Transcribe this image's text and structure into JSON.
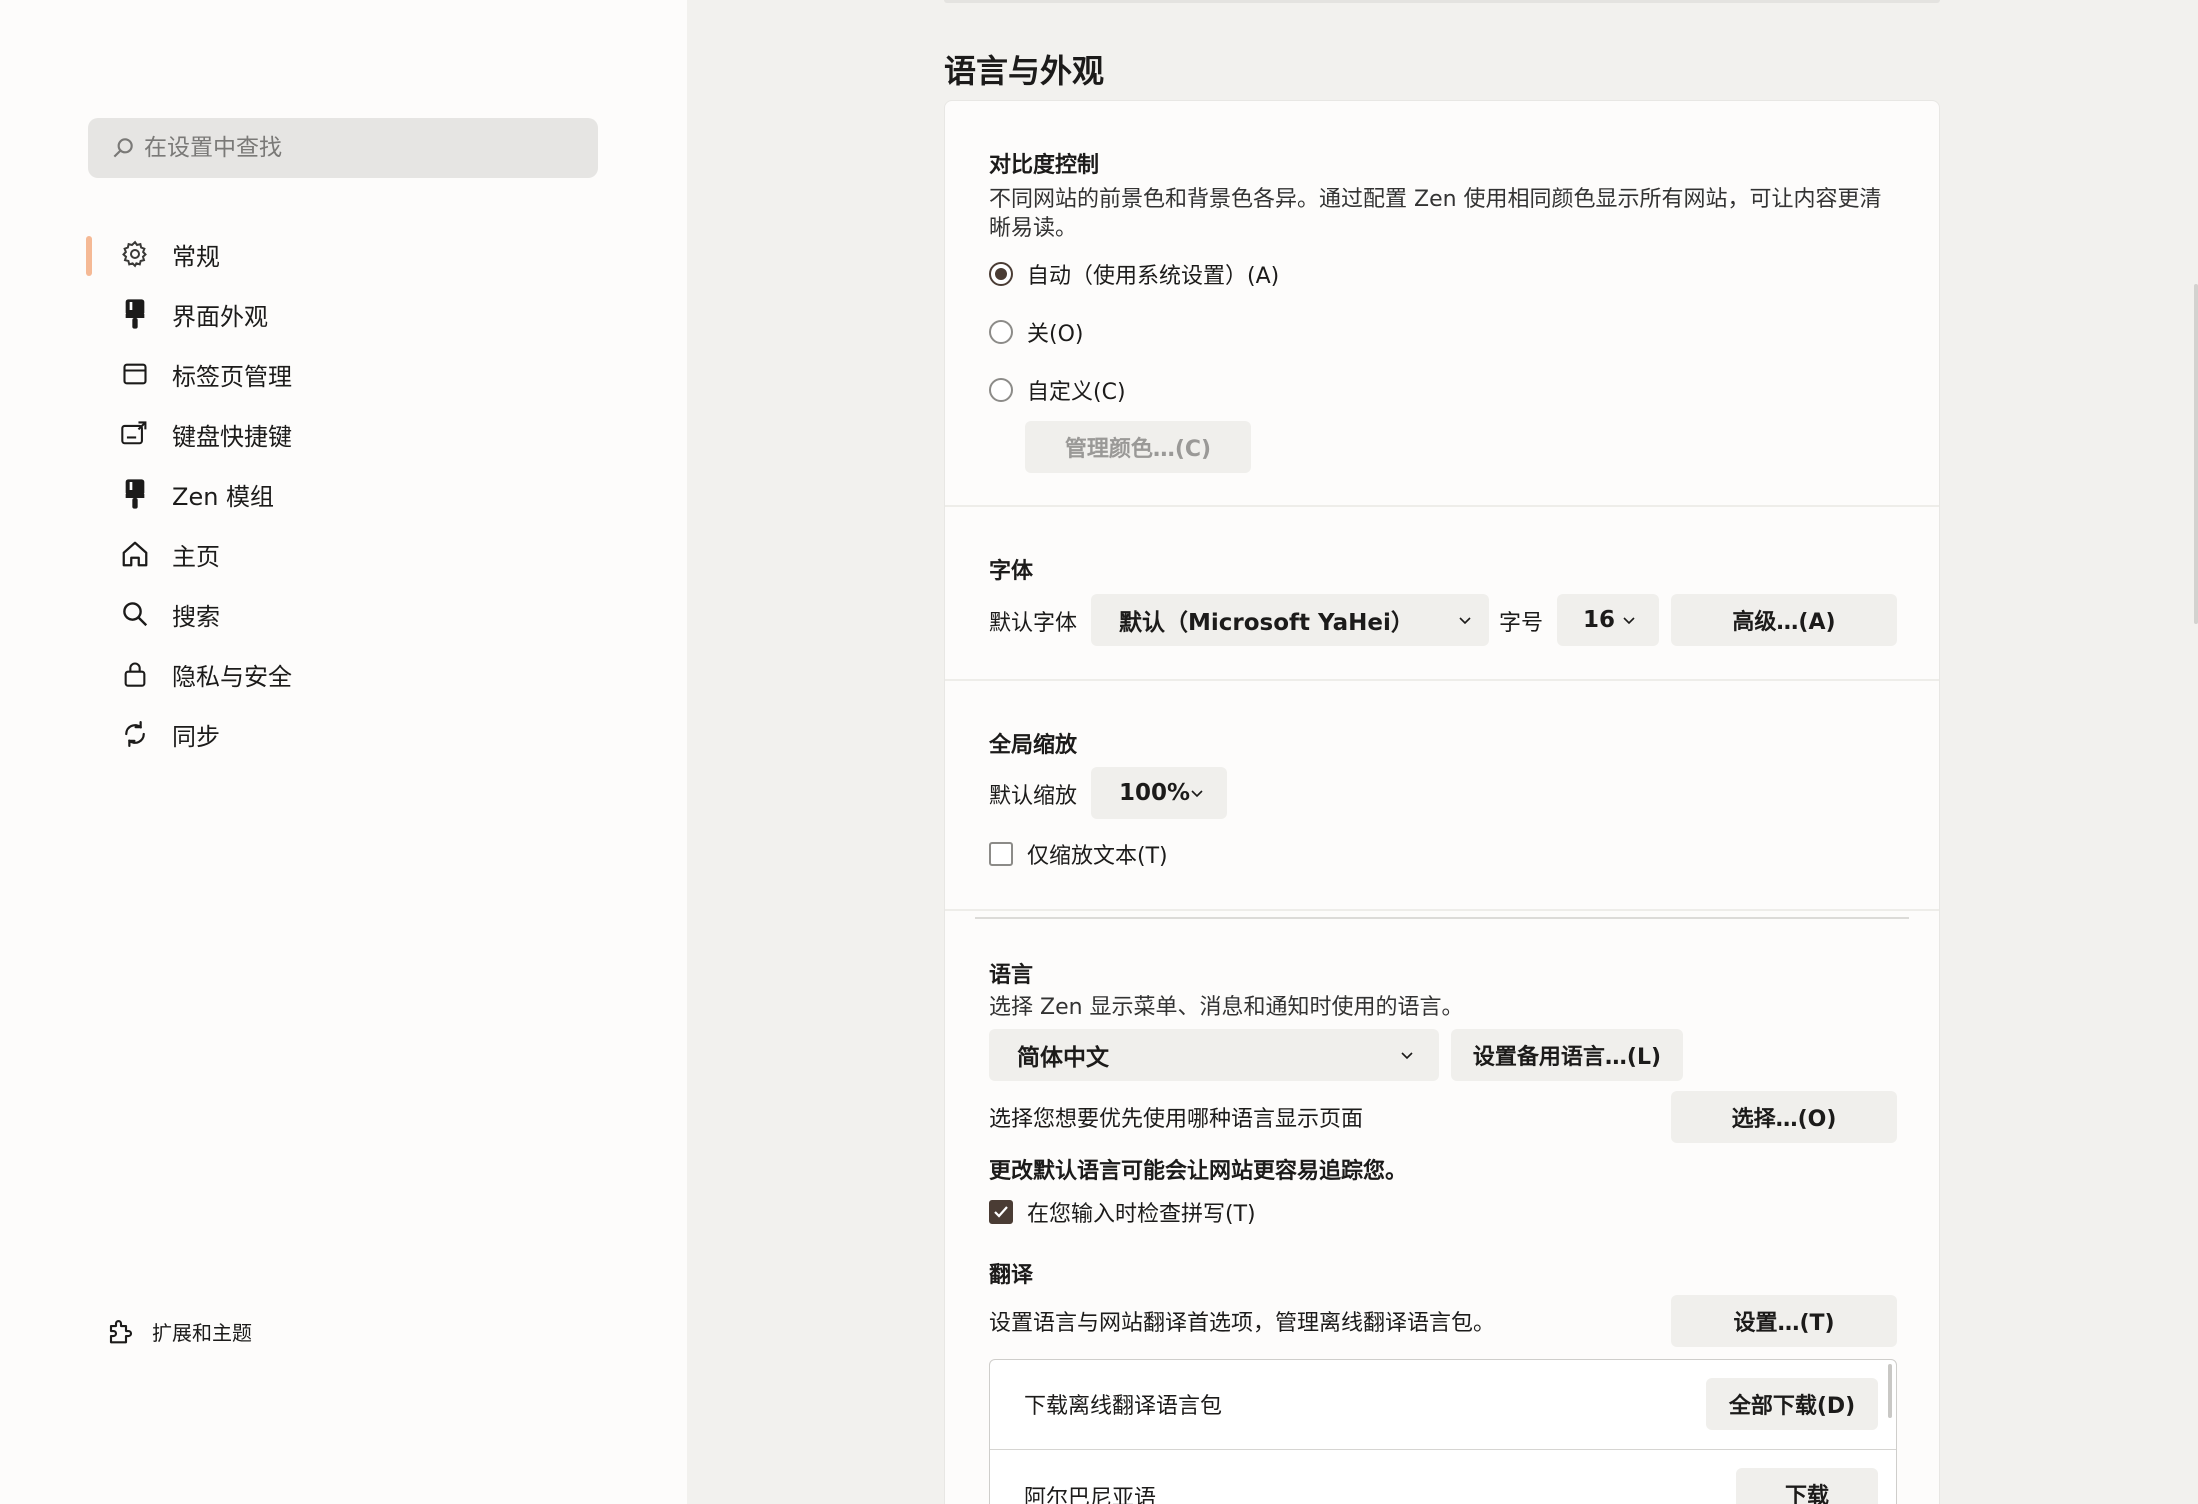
{
  "sidebar": {
    "search_placeholder": "在设置中查找",
    "accent_color": "#f5b995",
    "items": [
      {
        "label": "常规",
        "icon": "gear-icon",
        "active": true
      },
      {
        "label": "界面外观",
        "icon": "paintbrush-icon"
      },
      {
        "label": "标签页管理",
        "icon": "window-icon"
      },
      {
        "label": "键盘快捷键",
        "icon": "keyboard-shortcut-icon"
      },
      {
        "label": "Zen 模组",
        "icon": "paintbrush-icon"
      },
      {
        "label": "主页",
        "icon": "home-icon"
      },
      {
        "label": "搜索",
        "icon": "search-icon"
      },
      {
        "label": "隐私与安全",
        "icon": "lock-icon"
      },
      {
        "label": "同步",
        "icon": "sync-icon"
      }
    ],
    "footer_label": "扩展和主题"
  },
  "main": {
    "title": "语言与外观",
    "contrast": {
      "title": "对比度控制",
      "description": "不同网站的前景色和背景色各异。通过配置 Zen 使用相同颜色显示所有网站，可让内容更清晰易读。",
      "options": [
        "自动（使用系统设置）(A)",
        "关(O)",
        "自定义(C)"
      ],
      "selected": 0,
      "manage_colors_label": "管理颜色…(C)"
    },
    "fonts": {
      "title": "字体",
      "default_font_label": "默认字体",
      "default_font_value": "默认（Microsoft YaHei）",
      "size_label": "字号",
      "size_value": "16",
      "advanced_label": "高级…(A)"
    },
    "zoom": {
      "title": "全局缩放",
      "default_zoom_label": "默认缩放",
      "default_zoom_value": "100%",
      "text_only_label": "仅缩放文本(T)",
      "text_only_checked": false
    },
    "language": {
      "title": "语言",
      "description": "选择 Zen 显示菜单、消息和通知时使用的语言。",
      "selected_language": "简体中文",
      "alternatives_label": "设置备用语言…(L)",
      "page_language_label": "选择您想要优先使用哪种语言显示页面",
      "choose_label": "选择…(O)",
      "warning": "更改默认语言可能会让网站更容易追踪您。",
      "spellcheck_label": "在您输入时检查拼写(T)",
      "spellcheck_checked": true
    },
    "translation": {
      "title": "翻译",
      "description": "设置语言与网站翻译首选项，管理离线翻译语言包。",
      "settings_label": "设置…(T)",
      "rows": [
        {
          "label": "下载离线翻译语言包",
          "button": "全部下载(D)"
        },
        {
          "label": "阿尔巴尼亚语",
          "button": "下载"
        }
      ]
    }
  }
}
